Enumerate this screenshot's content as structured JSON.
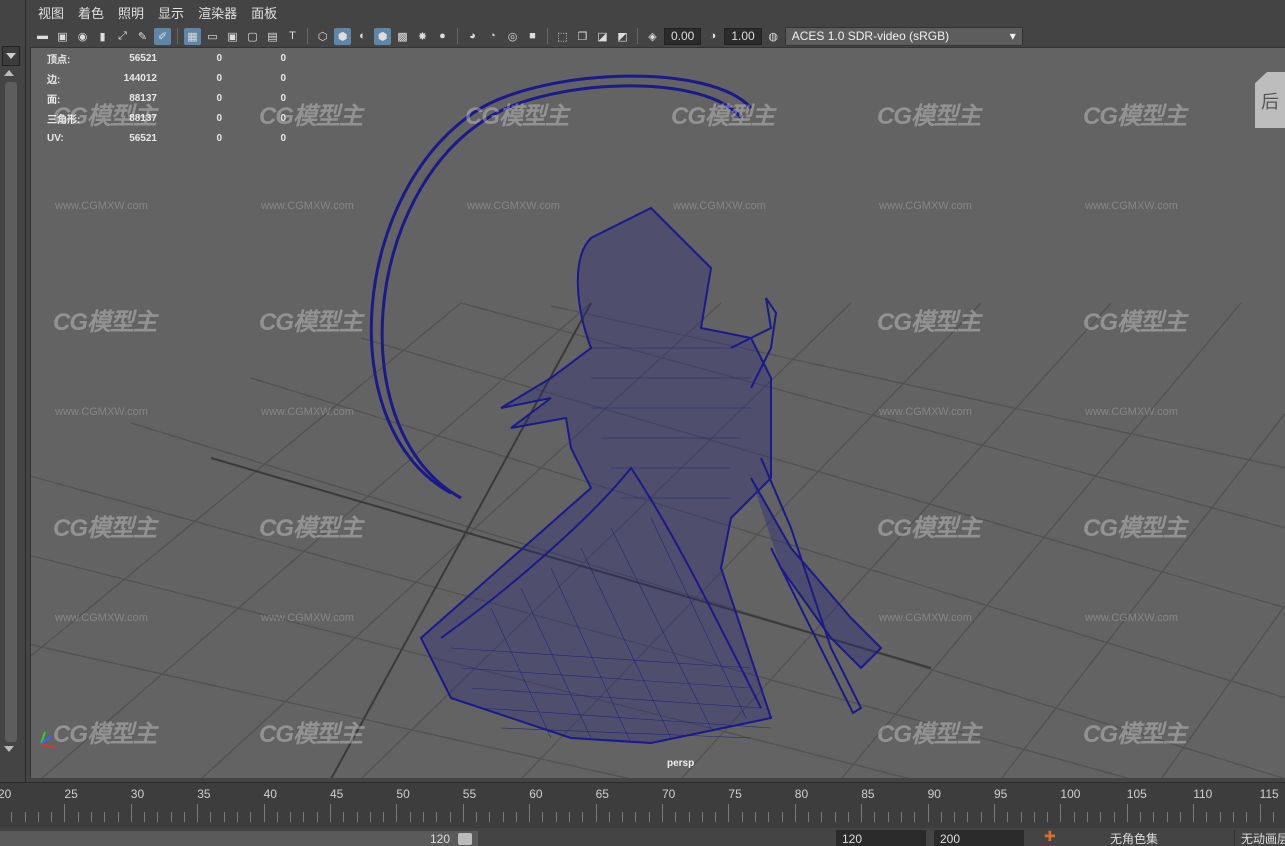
{
  "menu": [
    "视图",
    "着色",
    "照明",
    "显示",
    "渲染器",
    "面板"
  ],
  "toolbar": {
    "exposure_value": "0.00",
    "gamma_value": "1.00",
    "colorspace": "ACES 1.0 SDR-video (sRGB)"
  },
  "hud": {
    "rows": [
      {
        "label": "顶点:",
        "v1": "56521",
        "v2": "0",
        "v3": "0"
      },
      {
        "label": "边:",
        "v1": "144012",
        "v2": "0",
        "v3": "0"
      },
      {
        "label": "面:",
        "v1": "88137",
        "v2": "0",
        "v3": "0"
      },
      {
        "label": "三角形:",
        "v1": "88137",
        "v2": "0",
        "v3": "0"
      },
      {
        "label": "UV:",
        "v1": "56521",
        "v2": "0",
        "v3": "0"
      }
    ]
  },
  "viewport": {
    "camera": "persp",
    "viewcube_face": "后",
    "watermark_logo": "CG模型主",
    "watermark_url": "www.CGMXW.com",
    "wireframe_color": "#1a1a8a",
    "background_color": "#636363"
  },
  "timeline": {
    "ticks": [
      "20",
      "25",
      "30",
      "35",
      "40",
      "45",
      "50",
      "55",
      "60",
      "65",
      "70",
      "75",
      "80",
      "85",
      "90",
      "95",
      "100",
      "105",
      "110",
      "115"
    ]
  },
  "range": {
    "end": "120",
    "anim_end": "120",
    "playback_end": "200",
    "character_set": "无角色集",
    "anim_layer": "无动画层"
  }
}
